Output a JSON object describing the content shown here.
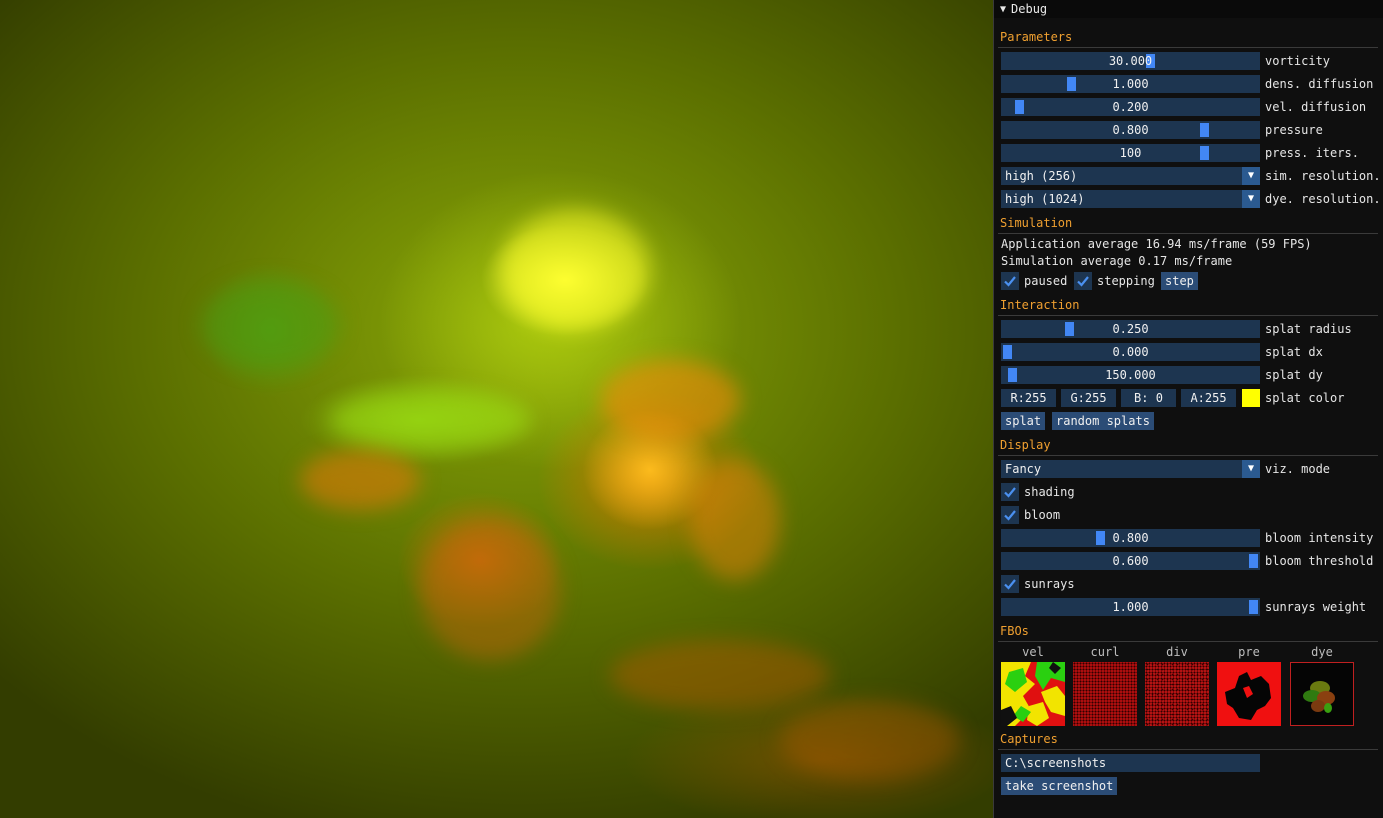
{
  "window": {
    "title": "Debug"
  },
  "sections": {
    "parameters": "Parameters",
    "simulation": "Simulation",
    "interaction": "Interaction",
    "display": "Display",
    "fbos": "FBOs",
    "captures": "Captures"
  },
  "parameters": {
    "vorticity": {
      "value": "30.000",
      "label": "vorticity",
      "fraction": 0.58
    },
    "dens_diffusion": {
      "value": "1.000",
      "label": "dens. diffusion",
      "fraction": 0.26
    },
    "vel_diffusion": {
      "value": "0.200",
      "label": "vel. diffusion",
      "fraction": 0.05
    },
    "pressure": {
      "value": "0.800",
      "label": "pressure",
      "fraction": 0.8
    },
    "press_iters": {
      "value": "100",
      "label": "press. iters.",
      "fraction": 0.8
    },
    "sim_resolution": {
      "value": "high (256)",
      "label": "sim. resolution."
    },
    "dye_resolution": {
      "value": "high (1024)",
      "label": "dye. resolution."
    }
  },
  "simulation": {
    "app_average": "Application average 16.94 ms/frame (59 FPS)",
    "sim_average": "Simulation average 0.17 ms/frame",
    "paused_label": "paused",
    "paused": true,
    "stepping_label": "stepping",
    "stepping": true,
    "step_label": "step"
  },
  "interaction": {
    "splat_radius": {
      "value": "0.250",
      "label": "splat radius",
      "fraction": 0.25
    },
    "splat_dx": {
      "value": "0.000",
      "label": "splat dx",
      "fraction": 0.0
    },
    "splat_dy": {
      "value": "150.000",
      "label": "splat dy",
      "fraction": 0.02
    },
    "color": {
      "r": "R:255",
      "g": "G:255",
      "b": "B:  0",
      "a": "A:255",
      "label": "splat color",
      "swatch": "#ffff00"
    },
    "splat_label": "splat",
    "random_splats_label": "random splats"
  },
  "display": {
    "viz_mode": {
      "value": "Fancy",
      "label": "viz. mode"
    },
    "shading_label": "shading",
    "shading": true,
    "bloom_label": "bloom",
    "bloom": true,
    "bloom_intensity": {
      "value": "0.800",
      "label": "bloom intensity",
      "fraction": 0.38
    },
    "bloom_threshold": {
      "value": "0.600",
      "label": "bloom threshold",
      "fraction": 1.0
    },
    "sunrays_label": "sunrays",
    "sunrays": true,
    "sunrays_weight": {
      "value": "1.000",
      "label": "sunrays weight",
      "fraction": 1.0
    }
  },
  "fbos": [
    "vel",
    "curl",
    "div",
    "pre",
    "dye"
  ],
  "captures": {
    "path": "C:\\screenshots",
    "take_label": "take screenshot"
  },
  "colors": {
    "accent": "#4287f5",
    "frame_bg": "#1d3550",
    "button_bg": "#2b4c76",
    "section_header": "#f0a030",
    "panel_bg": "#0f0f0f"
  },
  "icons": {
    "collapse": "triangle-down-icon",
    "combo_arrow": "triangle-down-icon",
    "check": "checkmark-icon"
  }
}
